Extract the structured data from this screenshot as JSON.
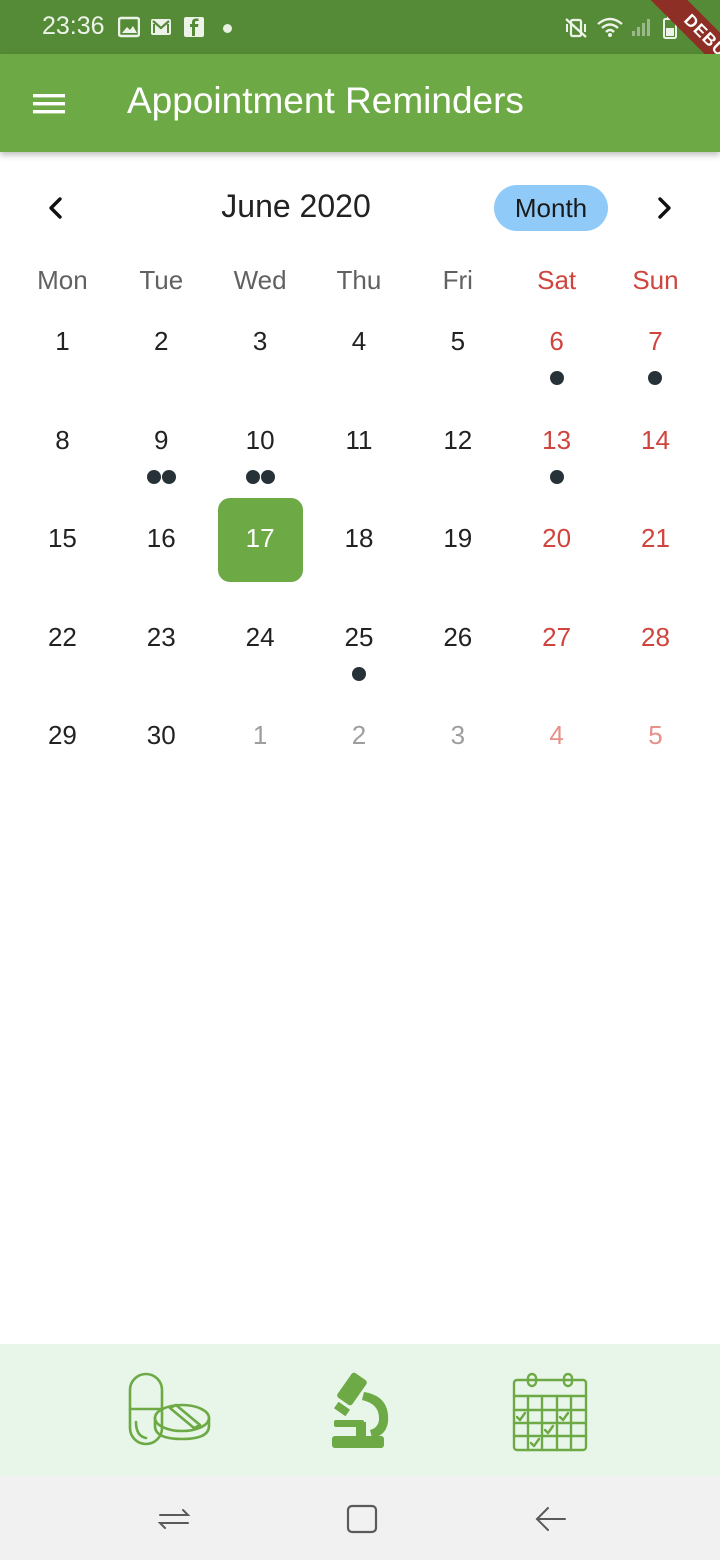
{
  "status_bar": {
    "time": "23:36",
    "left_icons": [
      "image-icon",
      "gmail-icon",
      "facebook-icon",
      "dot-icon"
    ],
    "right_icons": [
      "mute-vibrate-icon",
      "wifi-icon",
      "signal-icon",
      "battery-icon"
    ]
  },
  "debug_banner": {
    "label": "DEBUG",
    "color": "#8e2f25"
  },
  "app_bar": {
    "title": "Appointment Reminders",
    "menu_icon": "hamburger-menu-icon",
    "color": "#6daa45"
  },
  "calendar": {
    "month_label": "June 2020",
    "format_button": "Month",
    "prev_icon": "chevron-left-icon",
    "next_icon": "chevron-right-icon",
    "weekdays": [
      "Mon",
      "Tue",
      "Wed",
      "Thu",
      "Fri",
      "Sat",
      "Sun"
    ],
    "selected_day": "17",
    "weekend_color": "#d0443e",
    "selected_color": "#6daa45",
    "days": [
      {
        "label": "1",
        "outside": false,
        "events": 0
      },
      {
        "label": "2",
        "outside": false,
        "events": 0
      },
      {
        "label": "3",
        "outside": false,
        "events": 0
      },
      {
        "label": "4",
        "outside": false,
        "events": 0
      },
      {
        "label": "5",
        "outside": false,
        "events": 0
      },
      {
        "label": "6",
        "outside": false,
        "events": 1
      },
      {
        "label": "7",
        "outside": false,
        "events": 1
      },
      {
        "label": "8",
        "outside": false,
        "events": 0
      },
      {
        "label": "9",
        "outside": false,
        "events": 2
      },
      {
        "label": "10",
        "outside": false,
        "events": 2
      },
      {
        "label": "11",
        "outside": false,
        "events": 0
      },
      {
        "label": "12",
        "outside": false,
        "events": 0
      },
      {
        "label": "13",
        "outside": false,
        "events": 1
      },
      {
        "label": "14",
        "outside": false,
        "events": 0
      },
      {
        "label": "15",
        "outside": false,
        "events": 0
      },
      {
        "label": "16",
        "outside": false,
        "events": 0
      },
      {
        "label": "17",
        "outside": false,
        "events": 0
      },
      {
        "label": "18",
        "outside": false,
        "events": 0
      },
      {
        "label": "19",
        "outside": false,
        "events": 0
      },
      {
        "label": "20",
        "outside": false,
        "events": 0
      },
      {
        "label": "21",
        "outside": false,
        "events": 0
      },
      {
        "label": "22",
        "outside": false,
        "events": 0
      },
      {
        "label": "23",
        "outside": false,
        "events": 0
      },
      {
        "label": "24",
        "outside": false,
        "events": 0
      },
      {
        "label": "25",
        "outside": false,
        "events": 1
      },
      {
        "label": "26",
        "outside": false,
        "events": 0
      },
      {
        "label": "27",
        "outside": false,
        "events": 0
      },
      {
        "label": "28",
        "outside": false,
        "events": 0
      },
      {
        "label": "29",
        "outside": false,
        "events": 0
      },
      {
        "label": "30",
        "outside": false,
        "events": 0
      },
      {
        "label": "1",
        "outside": true,
        "events": 0
      },
      {
        "label": "2",
        "outside": true,
        "events": 0
      },
      {
        "label": "3",
        "outside": true,
        "events": 0
      },
      {
        "label": "4",
        "outside": true,
        "events": 0
      },
      {
        "label": "5",
        "outside": true,
        "events": 0
      }
    ]
  },
  "bottom_nav": {
    "items": [
      {
        "icon": "pills-icon"
      },
      {
        "icon": "microscope-icon"
      },
      {
        "icon": "calendar-check-icon"
      }
    ],
    "color": "#6daa45",
    "background": "#e8f5e9"
  },
  "system_nav": {
    "items": [
      {
        "icon": "recent-apps-icon"
      },
      {
        "icon": "home-icon"
      },
      {
        "icon": "back-icon"
      }
    ]
  }
}
